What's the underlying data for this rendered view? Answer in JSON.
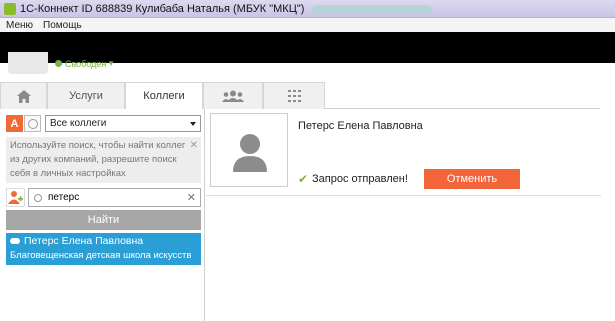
{
  "window": {
    "title": "1С-Коннект ID 688839 Кулибаба Наталья  (МБУК  \"МКЦ\")"
  },
  "menu": {
    "items": [
      "Меню",
      "Помощь"
    ]
  },
  "profile": {
    "status": "Свободен"
  },
  "tabs": {
    "services": "Услуги",
    "colleagues": "Коллеги"
  },
  "sidebar": {
    "btn_a": "A",
    "filter_value": "Все коллеги",
    "hint": "Используйте поиск, чтобы найти коллег из других компаний, разрешите поиск себя в личных настройках",
    "hint_close": "✕",
    "search_value": "петерс",
    "search_clear": "✕",
    "find_label": "Найти",
    "result": {
      "name": "Петерс Елена Павловна",
      "org": "Благовещенская детская школа искусств"
    }
  },
  "detail": {
    "name": "Петерс Елена Павловна",
    "check": "✔",
    "status": "Запрос отправлен!",
    "cancel_label": "Отменить"
  },
  "colors": {
    "accent": "#f2653a",
    "selection": "#2a9fd6",
    "online": "#7cb342"
  }
}
